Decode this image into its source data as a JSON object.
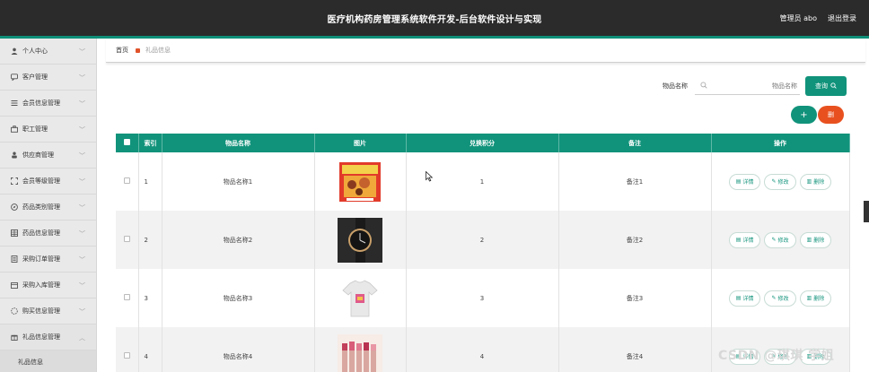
{
  "header": {
    "title": "医疗机构药房管理系统软件开发-后台软件设计与实现",
    "user": "管理员 abo",
    "logout": "退出登录"
  },
  "sidebar": {
    "items": [
      {
        "label": "个人中心",
        "icon": "user-icon"
      },
      {
        "label": "客户管理",
        "icon": "chat-icon"
      },
      {
        "label": "会员信息管理",
        "icon": "list-icon"
      },
      {
        "label": "职工管理",
        "icon": "briefcase-icon"
      },
      {
        "label": "供应商管理",
        "icon": "person-icon"
      },
      {
        "label": "会员等级管理",
        "icon": "frame-icon"
      },
      {
        "label": "药品类别管理",
        "icon": "compass-icon"
      },
      {
        "label": "药品信息管理",
        "icon": "grid-icon"
      },
      {
        "label": "采购订单管理",
        "icon": "doc-icon"
      },
      {
        "label": "采购入库管理",
        "icon": "box-icon"
      },
      {
        "label": "购买信息管理",
        "icon": "cart-icon"
      },
      {
        "label": "礼品信息管理",
        "icon": "gift-icon"
      }
    ],
    "subitem": "礼品信息"
  },
  "breadcrumb": {
    "home": "首页",
    "current": "礼品信息"
  },
  "search": {
    "label": "物品名称",
    "placeholder": "物品名称",
    "button": "查询"
  },
  "actions": {
    "add": "+",
    "delete": "删"
  },
  "table": {
    "columns": [
      "索引",
      "物品名称",
      "图片",
      "兑换积分",
      "备注",
      "操作"
    ],
    "rows": [
      {
        "index": "1",
        "name": "物品名称1",
        "image": "snack-box",
        "points": "1",
        "note": "备注1"
      },
      {
        "index": "2",
        "name": "物品名称2",
        "image": "watch",
        "points": "2",
        "note": "备注2"
      },
      {
        "index": "3",
        "name": "物品名称3",
        "image": "tshirt",
        "points": "3",
        "note": "备注3"
      },
      {
        "index": "4",
        "name": "物品名称4",
        "image": "lipsticks",
        "points": "4",
        "note": "备注4"
      }
    ],
    "ops": {
      "detail": "详情",
      "edit": "修改",
      "remove": "删除"
    }
  },
  "watermark": "CSDN @琪琪 学姐",
  "colors": {
    "accent": "#11937b",
    "danger": "#e8511f",
    "header": "#2b2b2b"
  }
}
